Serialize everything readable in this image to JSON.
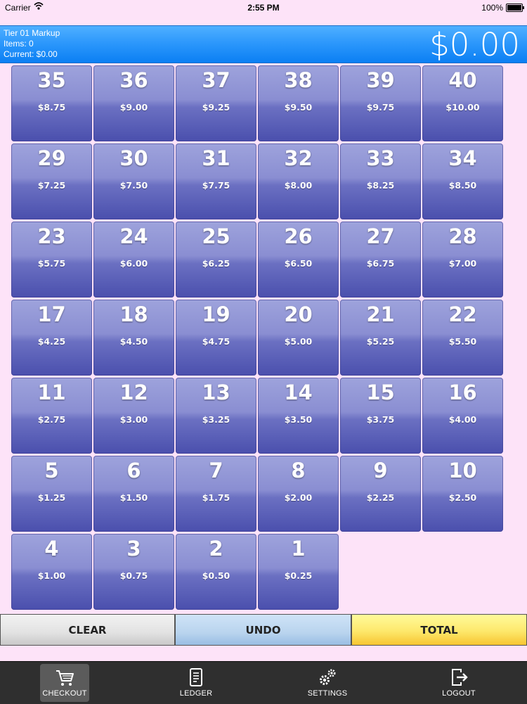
{
  "status_bar": {
    "carrier": "Carrier",
    "time": "2:55 PM",
    "battery": "100%"
  },
  "header": {
    "tier": "Tier 01 Markup",
    "items": "Items: 0",
    "current": "Current: $0.00",
    "total": "$0.00",
    "background": "#1a8cff"
  },
  "tiles": [
    {
      "number": "35",
      "price": "$8.75"
    },
    {
      "number": "36",
      "price": "$9.00"
    },
    {
      "number": "37",
      "price": "$9.25"
    },
    {
      "number": "38",
      "price": "$9.50"
    },
    {
      "number": "39",
      "price": "$9.75"
    },
    {
      "number": "40",
      "price": "$10.00"
    },
    {
      "number": "29",
      "price": "$7.25"
    },
    {
      "number": "30",
      "price": "$7.50"
    },
    {
      "number": "31",
      "price": "$7.75"
    },
    {
      "number": "32",
      "price": "$8.00"
    },
    {
      "number": "33",
      "price": "$8.25"
    },
    {
      "number": "34",
      "price": "$8.50"
    },
    {
      "number": "23",
      "price": "$5.75"
    },
    {
      "number": "24",
      "price": "$6.00"
    },
    {
      "number": "25",
      "price": "$6.25"
    },
    {
      "number": "26",
      "price": "$6.50"
    },
    {
      "number": "27",
      "price": "$6.75"
    },
    {
      "number": "28",
      "price": "$7.00"
    },
    {
      "number": "17",
      "price": "$4.25"
    },
    {
      "number": "18",
      "price": "$4.50"
    },
    {
      "number": "19",
      "price": "$4.75"
    },
    {
      "number": "20",
      "price": "$5.00"
    },
    {
      "number": "21",
      "price": "$5.25"
    },
    {
      "number": "22",
      "price": "$5.50"
    },
    {
      "number": "11",
      "price": "$2.75"
    },
    {
      "number": "12",
      "price": "$3.00"
    },
    {
      "number": "13",
      "price": "$3.25"
    },
    {
      "number": "14",
      "price": "$3.50"
    },
    {
      "number": "15",
      "price": "$3.75"
    },
    {
      "number": "16",
      "price": "$4.00"
    },
    {
      "number": "5",
      "price": "$1.25"
    },
    {
      "number": "6",
      "price": "$1.50"
    },
    {
      "number": "7",
      "price": "$1.75"
    },
    {
      "number": "8",
      "price": "$2.00"
    },
    {
      "number": "9",
      "price": "$2.25"
    },
    {
      "number": "10",
      "price": "$2.50"
    },
    {
      "number": "4",
      "price": "$1.00"
    },
    {
      "number": "3",
      "price": "$0.75"
    },
    {
      "number": "2",
      "price": "$0.50"
    },
    {
      "number": "1",
      "price": "$0.25"
    }
  ],
  "actions": {
    "clear": "CLEAR",
    "undo": "UNDO",
    "total": "TOTAL"
  },
  "tabbar": {
    "checkout": {
      "label": "CHECKOUT",
      "icon": "cart-icon",
      "active": true
    },
    "ledger": {
      "label": "LEDGER",
      "icon": "ledger-icon"
    },
    "settings": {
      "label": "SETTINGS",
      "icon": "gears-icon"
    },
    "logout": {
      "label": "LOGOUT",
      "icon": "logout-icon"
    }
  },
  "colors": {
    "background": "#fde3f8",
    "tile": "#6b70c2",
    "header": "#1a8cff",
    "total_button": "#fde86b",
    "undo_button": "#b9d4ee",
    "clear_button": "#e2e2e2",
    "tabbar": "#2f2f2f"
  }
}
